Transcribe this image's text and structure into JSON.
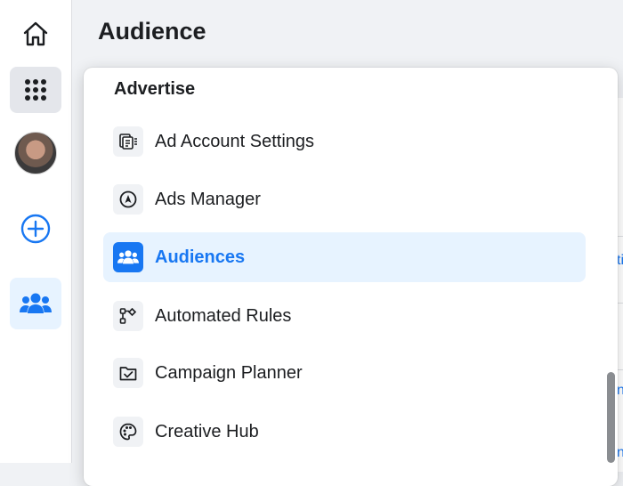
{
  "header": {
    "title": "Audience"
  },
  "rail": {
    "items": [
      {
        "name": "home",
        "icon": "home-icon"
      },
      {
        "name": "all-tools",
        "icon": "grid-icon"
      },
      {
        "name": "profile",
        "icon": "avatar"
      },
      {
        "name": "create",
        "icon": "plus-circle-icon"
      },
      {
        "name": "audience",
        "icon": "people-icon",
        "active": true
      }
    ]
  },
  "menu": {
    "section_title": "Advertise",
    "items": [
      {
        "label": "Ad Account Settings",
        "icon": "ad-account-settings-icon"
      },
      {
        "label": "Ads Manager",
        "icon": "compass-icon"
      },
      {
        "label": "Audiences",
        "icon": "people-icon",
        "active": true
      },
      {
        "label": "Automated Rules",
        "icon": "automation-rules-icon"
      },
      {
        "label": "Campaign Planner",
        "icon": "folder-check-icon"
      },
      {
        "label": "Creative Hub",
        "icon": "palette-icon"
      }
    ]
  },
  "background": {
    "fragments": [
      "ti",
      "n",
      "n"
    ]
  },
  "colors": {
    "accent": "#1877f2",
    "active_bg": "#e7f3ff",
    "rail_selected_bg": "#e4e6eb"
  }
}
